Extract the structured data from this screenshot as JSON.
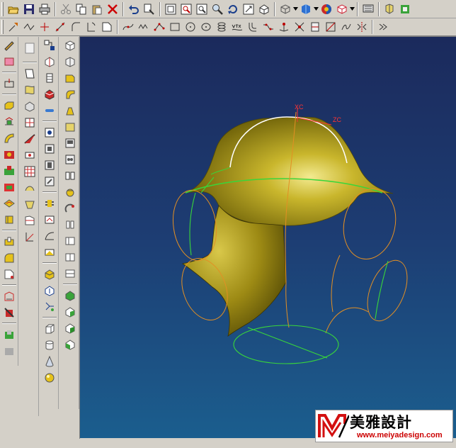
{
  "toolbar_top": {
    "buttons": [
      "open-icon",
      "save-icon",
      "print-icon",
      "cut-icon",
      "copy-icon",
      "paste-icon",
      "delete-icon",
      "undo-icon",
      "layer-icon",
      "fit-view-icon",
      "zoom-window-icon",
      "zoom-icon",
      "zoom-in-out-icon",
      "rotate-icon",
      "pan-icon",
      "view-orient-icon",
      "wireframe-icon",
      "render-style-icon",
      "shade-icon",
      "color-icon",
      "display-icon",
      "refresh-icon",
      "tools-icon",
      "expand-icon"
    ]
  },
  "toolbar_curve": {
    "buttons": [
      "point-icon",
      "polyline-icon",
      "crosshair-icon",
      "line-icon",
      "arc-icon",
      "fillet-icon",
      "chamfer-icon",
      "spline-curve-icon",
      "wave-curve-icon",
      "point-set-icon",
      "rectangle-icon",
      "circle-icon",
      "ellipse-icon",
      "helix-icon",
      "text-curve-icon",
      "offset-curve-icon",
      "bridge-curve-icon",
      "project-curve-icon",
      "intersect-curve-icon",
      "section-curve-icon",
      "extract-curve-icon",
      "join-curve-icon",
      "mirror-curve-icon",
      "more-icon"
    ]
  },
  "palettes": {
    "col1": [
      "sketch-icon",
      "feature-icon",
      "datum-plane-icon",
      "extrude-icon",
      "revolve-icon",
      "sweep-icon",
      "hole-icon",
      "boss-icon",
      "pocket-icon",
      "pad-icon",
      "slot-icon",
      "groove-icon",
      "blend-icon",
      "chamfer-edge-icon",
      "shell-icon",
      "draft-icon",
      "trim-body-icon",
      "split-body-icon",
      "unite-icon",
      "subtract-icon"
    ],
    "col2": [
      "through-curves-icon",
      "ruled-surface-icon",
      "swept-surface-icon",
      "bounded-plane-icon",
      "n-sided-surface-icon",
      "extension-icon",
      "offset-surface-icon",
      "quilt-icon",
      "global-shaping-icon",
      "enlarge-icon",
      "transition-icon",
      "law-extension-icon"
    ],
    "col3": [
      "edit-feature-icon",
      "move-feature-icon",
      "reorder-icon",
      "suppress-icon",
      "unsuppress-icon",
      "replace-icon",
      "pattern-icon",
      "mirror-feature-icon",
      "sew-icon",
      "patch-icon",
      "offset-face-icon",
      "scale-body-icon",
      "wrap-icon",
      "unwrap-icon",
      "promote-icon",
      "instance-icon",
      "analysis-icon",
      "measure-icon",
      "block-icon",
      "cylinder-icon",
      "cone-icon",
      "sphere-icon"
    ],
    "col4": [
      "solid-block-icon",
      "solid-cube-icon",
      "face-blend-icon",
      "soft-blend-icon",
      "cliff-blend-icon",
      "bridge-face-icon",
      "trimmed-sheet-icon",
      "thicken-icon",
      "mesh-icon",
      "curve-mesh-icon",
      "studio-surface-icon",
      "styled-blend-icon",
      "face-trim-icon",
      "sheet-sew-icon",
      "silhouette-icon",
      "transform-icon",
      "color-face-icon",
      "green-shade-icon",
      "paint-icon"
    ]
  },
  "viewport": {
    "wcs_labels": {
      "x": "XC",
      "z": "ZC"
    }
  },
  "logo": {
    "chinese": "美雅設計",
    "url": "www.meiyadesign.com"
  },
  "colors": {
    "surface": "#b4a21a",
    "curve_green": "#39d63a",
    "curve_orange": "#e38f23",
    "highlight_white": "#ffffff",
    "axis_red": "#ff3333"
  }
}
